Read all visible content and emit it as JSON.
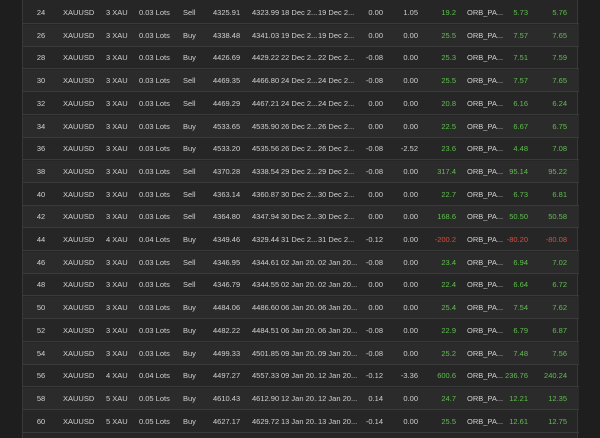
{
  "colors": {
    "positive": "#5fbf4f",
    "negative": "#e04a3a",
    "text": "#d0d0d0"
  },
  "rows": [
    {
      "id": "24",
      "symbol": "XAUUSD",
      "size": "3 XAU",
      "lots": "0.03 Lots",
      "side": "Sell",
      "open_price": "4325.91",
      "close_price": "4323.99",
      "open_time": "18 Dec 2...",
      "close_time": "19 Dec 2...",
      "commission": "0.00",
      "swap": "1.05",
      "profit": "19.2",
      "label": "ORB_PA...",
      "pnl": "5.73",
      "net": "5.76",
      "profit_sign": "pos",
      "pnl_sign": "pos",
      "net_sign": "pos"
    },
    {
      "id": "26",
      "symbol": "XAUUSD",
      "size": "3 XAU",
      "lots": "0.03 Lots",
      "side": "Buy",
      "open_price": "4338.48",
      "close_price": "4341.03",
      "open_time": "19 Dec 2...",
      "close_time": "19 Dec 2...",
      "commission": "0.00",
      "swap": "0.00",
      "profit": "25.5",
      "label": "ORB_PA...",
      "pnl": "7.57",
      "net": "7.65",
      "profit_sign": "pos",
      "pnl_sign": "pos",
      "net_sign": "pos"
    },
    {
      "id": "28",
      "symbol": "XAUUSD",
      "size": "3 XAU",
      "lots": "0.03 Lots",
      "side": "Buy",
      "open_price": "4426.69",
      "close_price": "4429.22",
      "open_time": "22 Dec 2...",
      "close_time": "22 Dec 2...",
      "commission": "-0.08",
      "swap": "0.00",
      "profit": "25.3",
      "label": "ORB_PA...",
      "pnl": "7.51",
      "net": "7.59",
      "profit_sign": "pos",
      "pnl_sign": "pos",
      "net_sign": "pos"
    },
    {
      "id": "30",
      "symbol": "XAUUSD",
      "size": "3 XAU",
      "lots": "0.03 Lots",
      "side": "Sell",
      "open_price": "4469.35",
      "close_price": "4466.80",
      "open_time": "24 Dec 2...",
      "close_time": "24 Dec 2...",
      "commission": "-0.08",
      "swap": "0.00",
      "profit": "25.5",
      "label": "ORB_PA...",
      "pnl": "7.57",
      "net": "7.65",
      "profit_sign": "pos",
      "pnl_sign": "pos",
      "net_sign": "pos"
    },
    {
      "id": "32",
      "symbol": "XAUUSD",
      "size": "3 XAU",
      "lots": "0.03 Lots",
      "side": "Sell",
      "open_price": "4469.29",
      "close_price": "4467.21",
      "open_time": "24 Dec 2...",
      "close_time": "24 Dec 2...",
      "commission": "0.00",
      "swap": "0.00",
      "profit": "20.8",
      "label": "ORB_PA...",
      "pnl": "6.16",
      "net": "6.24",
      "profit_sign": "pos",
      "pnl_sign": "pos",
      "net_sign": "pos"
    },
    {
      "id": "34",
      "symbol": "XAUUSD",
      "size": "3 XAU",
      "lots": "0.03 Lots",
      "side": "Buy",
      "open_price": "4533.65",
      "close_price": "4535.90",
      "open_time": "26 Dec 2...",
      "close_time": "26 Dec 2...",
      "commission": "0.00",
      "swap": "0.00",
      "profit": "22.5",
      "label": "ORB_PA...",
      "pnl": "6.67",
      "net": "6.75",
      "profit_sign": "pos",
      "pnl_sign": "pos",
      "net_sign": "pos"
    },
    {
      "id": "36",
      "symbol": "XAUUSD",
      "size": "3 XAU",
      "lots": "0.03 Lots",
      "side": "Buy",
      "open_price": "4533.20",
      "close_price": "4535.56",
      "open_time": "26 Dec 2...",
      "close_time": "26 Dec 2...",
      "commission": "-0.08",
      "swap": "-2.52",
      "profit": "23.6",
      "label": "ORB_PA...",
      "pnl": "4.48",
      "net": "7.08",
      "profit_sign": "pos",
      "pnl_sign": "pos",
      "net_sign": "pos"
    },
    {
      "id": "38",
      "symbol": "XAUUSD",
      "size": "3 XAU",
      "lots": "0.03 Lots",
      "side": "Sell",
      "open_price": "4370.28",
      "close_price": "4338.54",
      "open_time": "29 Dec 2...",
      "close_time": "29 Dec 2...",
      "commission": "-0.08",
      "swap": "0.00",
      "profit": "317.4",
      "label": "ORB_PA...",
      "pnl": "95.14",
      "net": "95.22",
      "profit_sign": "pos",
      "pnl_sign": "pos",
      "net_sign": "pos"
    },
    {
      "id": "40",
      "symbol": "XAUUSD",
      "size": "3 XAU",
      "lots": "0.03 Lots",
      "side": "Sell",
      "open_price": "4363.14",
      "close_price": "4360.87",
      "open_time": "30 Dec 2...",
      "close_time": "30 Dec 2...",
      "commission": "0.00",
      "swap": "0.00",
      "profit": "22.7",
      "label": "ORB_PA...",
      "pnl": "6.73",
      "net": "6.81",
      "profit_sign": "pos",
      "pnl_sign": "pos",
      "net_sign": "pos"
    },
    {
      "id": "42",
      "symbol": "XAUUSD",
      "size": "3 XAU",
      "lots": "0.03 Lots",
      "side": "Sell",
      "open_price": "4364.80",
      "close_price": "4347.94",
      "open_time": "30 Dec 2...",
      "close_time": "30 Dec 2...",
      "commission": "0.00",
      "swap": "0.00",
      "profit": "168.6",
      "label": "ORB_PA...",
      "pnl": "50.50",
      "net": "50.58",
      "profit_sign": "pos",
      "pnl_sign": "pos",
      "net_sign": "pos"
    },
    {
      "id": "44",
      "symbol": "XAUUSD",
      "size": "4 XAU",
      "lots": "0.04 Lots",
      "side": "Buy",
      "open_price": "4349.46",
      "close_price": "4329.44",
      "open_time": "31 Dec 2...",
      "close_time": "31 Dec 2...",
      "commission": "-0.12",
      "swap": "0.00",
      "profit": "-200.2",
      "label": "ORB_PA...",
      "pnl": "-80.20",
      "net": "-80.08",
      "profit_sign": "neg",
      "pnl_sign": "neg",
      "net_sign": "neg"
    },
    {
      "id": "46",
      "symbol": "XAUUSD",
      "size": "3 XAU",
      "lots": "0.03 Lots",
      "side": "Sell",
      "open_price": "4346.95",
      "close_price": "4344.61",
      "open_time": "02 Jan 20...",
      "close_time": "02 Jan 20...",
      "commission": "-0.08",
      "swap": "0.00",
      "profit": "23.4",
      "label": "ORB_PA...",
      "pnl": "6.94",
      "net": "7.02",
      "profit_sign": "pos",
      "pnl_sign": "pos",
      "net_sign": "pos"
    },
    {
      "id": "48",
      "symbol": "XAUUSD",
      "size": "3 XAU",
      "lots": "0.03 Lots",
      "side": "Sell",
      "open_price": "4346.79",
      "close_price": "4344.55",
      "open_time": "02 Jan 20...",
      "close_time": "02 Jan 20...",
      "commission": "0.00",
      "swap": "0.00",
      "profit": "22.4",
      "label": "ORB_PA...",
      "pnl": "6.64",
      "net": "6.72",
      "profit_sign": "pos",
      "pnl_sign": "pos",
      "net_sign": "pos"
    },
    {
      "id": "50",
      "symbol": "XAUUSD",
      "size": "3 XAU",
      "lots": "0.03 Lots",
      "side": "Buy",
      "open_price": "4484.06",
      "close_price": "4486.60",
      "open_time": "06 Jan 20...",
      "close_time": "06 Jan 20...",
      "commission": "0.00",
      "swap": "0.00",
      "profit": "25.4",
      "label": "ORB_PA...",
      "pnl": "7.54",
      "net": "7.62",
      "profit_sign": "pos",
      "pnl_sign": "pos",
      "net_sign": "pos"
    },
    {
      "id": "52",
      "symbol": "XAUUSD",
      "size": "3 XAU",
      "lots": "0.03 Lots",
      "side": "Buy",
      "open_price": "4482.22",
      "close_price": "4484.51",
      "open_time": "06 Jan 20...",
      "close_time": "06 Jan 20...",
      "commission": "-0.08",
      "swap": "0.00",
      "profit": "22.9",
      "label": "ORB_PA...",
      "pnl": "6.79",
      "net": "6.87",
      "profit_sign": "pos",
      "pnl_sign": "pos",
      "net_sign": "pos"
    },
    {
      "id": "54",
      "symbol": "XAUUSD",
      "size": "3 XAU",
      "lots": "0.03 Lots",
      "side": "Buy",
      "open_price": "4499.33",
      "close_price": "4501.85",
      "open_time": "09 Jan 20...",
      "close_time": "09 Jan 20...",
      "commission": "-0.08",
      "swap": "0.00",
      "profit": "25.2",
      "label": "ORB_PA...",
      "pnl": "7.48",
      "net": "7.56",
      "profit_sign": "pos",
      "pnl_sign": "pos",
      "net_sign": "pos"
    },
    {
      "id": "56",
      "symbol": "XAUUSD",
      "size": "4 XAU",
      "lots": "0.04 Lots",
      "side": "Buy",
      "open_price": "4497.27",
      "close_price": "4557.33",
      "open_time": "09 Jan 20...",
      "close_time": "12 Jan 20...",
      "commission": "-0.12",
      "swap": "-3.36",
      "profit": "600.6",
      "label": "ORB_PA...",
      "pnl": "236.76",
      "net": "240.24",
      "profit_sign": "pos",
      "pnl_sign": "pos",
      "net_sign": "pos"
    },
    {
      "id": "58",
      "symbol": "XAUUSD",
      "size": "5 XAU",
      "lots": "0.05 Lots",
      "side": "Buy",
      "open_price": "4610.43",
      "close_price": "4612.90",
      "open_time": "12 Jan 20...",
      "close_time": "12 Jan 20...",
      "commission": "0.14",
      "swap": "0.00",
      "profit": "24.7",
      "label": "ORB_PA...",
      "pnl": "12.21",
      "net": "12.35",
      "profit_sign": "pos",
      "pnl_sign": "pos",
      "net_sign": "pos"
    },
    {
      "id": "60",
      "symbol": "XAUUSD",
      "size": "5 XAU",
      "lots": "0.05 Lots",
      "side": "Buy",
      "open_price": "4627.17",
      "close_price": "4629.72",
      "open_time": "13 Jan 20...",
      "close_time": "13 Jan 20...",
      "commission": "-0.14",
      "swap": "0.00",
      "profit": "25.5",
      "label": "ORB_PA...",
      "pnl": "12.61",
      "net": "12.75",
      "profit_sign": "pos",
      "pnl_sign": "pos",
      "net_sign": "pos"
    }
  ]
}
